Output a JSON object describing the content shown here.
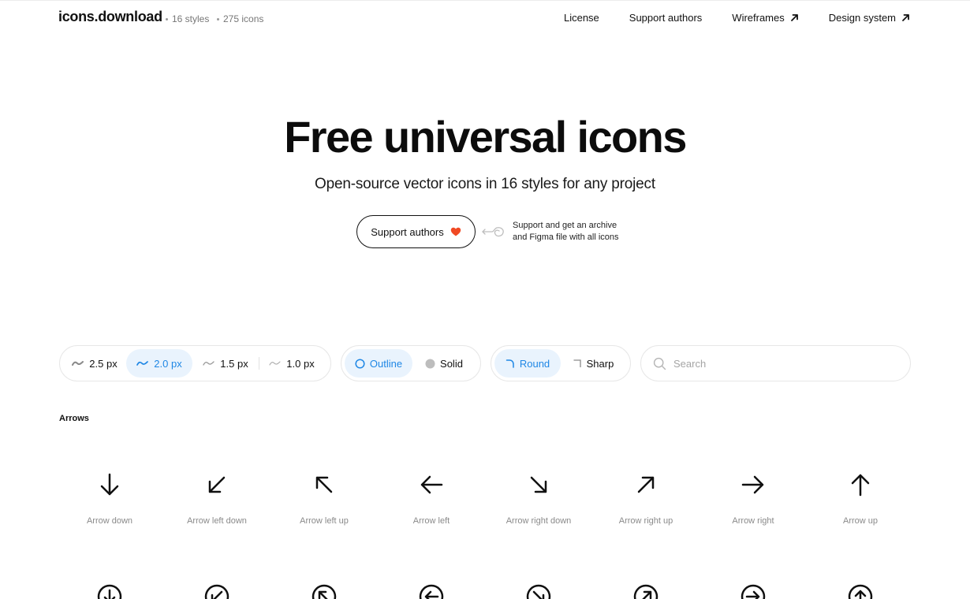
{
  "brand": "icons.download",
  "meta": {
    "styles": "16 styles",
    "icons": "275 icons"
  },
  "nav": {
    "license": "License",
    "support": "Support authors",
    "wireframes": "Wireframes",
    "design_system": "Design system"
  },
  "hero": {
    "title": "Free universal icons",
    "subtitle": "Open-source vector icons in 16 styles for any project",
    "cta": "Support authors",
    "note_line1": "Support and get an archive",
    "note_line2": "and Figma file with all icons"
  },
  "stroke_options": [
    {
      "label": "2.5 px",
      "active": false
    },
    {
      "label": "2.0 px",
      "active": true
    },
    {
      "label": "1.5 px",
      "active": false
    },
    {
      "label": "1.0 px",
      "active": false
    }
  ],
  "fill_options": [
    {
      "label": "Outline",
      "active": true
    },
    {
      "label": "Solid",
      "active": false
    }
  ],
  "corner_options": [
    {
      "label": "Round",
      "active": true
    },
    {
      "label": "Sharp",
      "active": false
    }
  ],
  "search": {
    "placeholder": "Search"
  },
  "section": {
    "title": "Arrows"
  },
  "icons_row1": [
    {
      "label": "Arrow down",
      "icon": "arrow-down-icon"
    },
    {
      "label": "Arrow left down",
      "icon": "arrow-left-down-icon"
    },
    {
      "label": "Arrow left up",
      "icon": "arrow-left-up-icon"
    },
    {
      "label": "Arrow left",
      "icon": "arrow-left-icon"
    },
    {
      "label": "Arrow right down",
      "icon": "arrow-right-down-icon"
    },
    {
      "label": "Arrow right up",
      "icon": "arrow-right-up-icon"
    },
    {
      "label": "Arrow right",
      "icon": "arrow-right-icon"
    },
    {
      "label": "Arrow up",
      "icon": "arrow-up-icon"
    }
  ],
  "icons_row2": [
    {
      "icon": "circle-arrow-down-icon"
    },
    {
      "icon": "circle-arrow-left-down-icon"
    },
    {
      "icon": "circle-arrow-left-up-icon"
    },
    {
      "icon": "circle-arrow-left-icon"
    },
    {
      "icon": "circle-arrow-right-down-icon"
    },
    {
      "icon": "circle-arrow-right-up-icon"
    },
    {
      "icon": "circle-arrow-right-icon"
    },
    {
      "icon": "circle-arrow-up-icon"
    }
  ],
  "colors": {
    "accent": "#1f87e5",
    "accent_bg": "#e9f3fd",
    "heart": "#f04a24"
  }
}
